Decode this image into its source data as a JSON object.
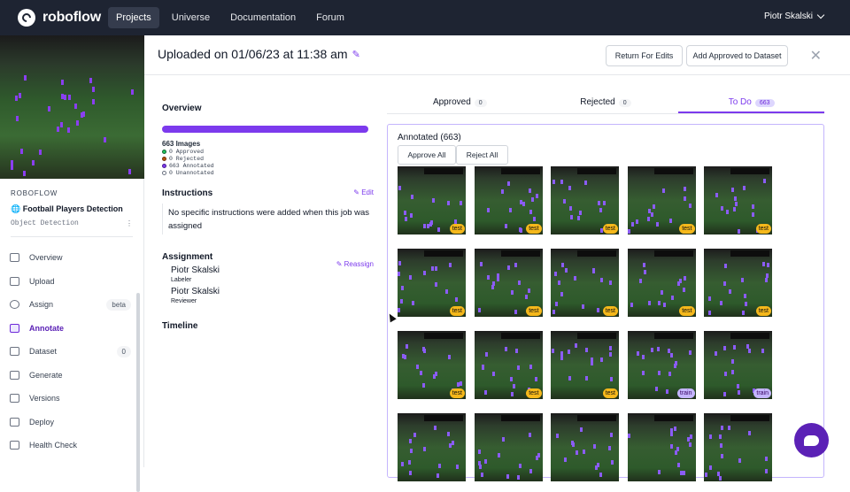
{
  "nav": {
    "logo": "roboflow",
    "links": [
      "Projects",
      "Universe",
      "Documentation",
      "Forum"
    ],
    "user": "Piotr Skalski"
  },
  "sidebar": {
    "workspace": "ROBOFLOW",
    "project_name": "Football Players Detection",
    "project_type": "Object Detection",
    "items": [
      {
        "label": "Overview",
        "icon": "overview-icon"
      },
      {
        "label": "Upload",
        "icon": "upload-icon"
      },
      {
        "label": "Assign",
        "icon": "search-icon",
        "pill": "beta"
      },
      {
        "label": "Annotate",
        "icon": "annotate-icon",
        "active": true
      },
      {
        "label": "Dataset",
        "icon": "dataset-icon",
        "pill": "0"
      },
      {
        "label": "Generate",
        "icon": "generate-icon"
      },
      {
        "label": "Versions",
        "icon": "folder-icon"
      },
      {
        "label": "Deploy",
        "icon": "rocket-icon"
      },
      {
        "label": "Health Check",
        "icon": "stethoscope-icon"
      }
    ]
  },
  "header": {
    "title": "Uploaded on 01/06/23 at 11:38 am",
    "return_button": "Return For Edits",
    "add_button": "Add Approved to Dataset"
  },
  "overview": {
    "heading": "Overview",
    "progress_fraction": 1.0,
    "images": "663 Images",
    "stats": [
      {
        "label": "0 Approved",
        "color": "#22c55e"
      },
      {
        "label": "0 Rejected",
        "color": "#b45309"
      },
      {
        "label": "663 Annotated",
        "color": "#7c3aed"
      },
      {
        "label": "0 Unannotated",
        "color": "#ffffff"
      }
    ]
  },
  "instructions": {
    "heading": "Instructions",
    "edit": "Edit",
    "text": "No specific instructions were added when this job was assigned"
  },
  "assignment": {
    "heading": "Assignment",
    "reassign": "Reassign",
    "labeler_name": "Piotr Skalski",
    "labeler_role": "Labeler",
    "reviewer_name": "Piotr Skalski",
    "reviewer_role": "Reviewer"
  },
  "timeline": {
    "heading": "Timeline"
  },
  "tabs": [
    {
      "label": "Approved",
      "count": "0"
    },
    {
      "label": "Rejected",
      "count": "0"
    },
    {
      "label": "To Do",
      "count": "663",
      "active": true
    }
  ],
  "panel": {
    "title": "Annotated (663)",
    "approve_all": "Approve All",
    "reject_all": "Reject All"
  },
  "images": [
    "test",
    "test",
    "test",
    "test",
    "test",
    "test",
    "test",
    "test",
    "test",
    "test",
    "test",
    "test",
    "test",
    "train",
    "train",
    "",
    "",
    "",
    "",
    ""
  ],
  "colors": {
    "accent": "#7c3aed",
    "nav_bg": "#1e2432",
    "tag_test": "#f5b81b",
    "tag_train": "#c4b5fd"
  }
}
